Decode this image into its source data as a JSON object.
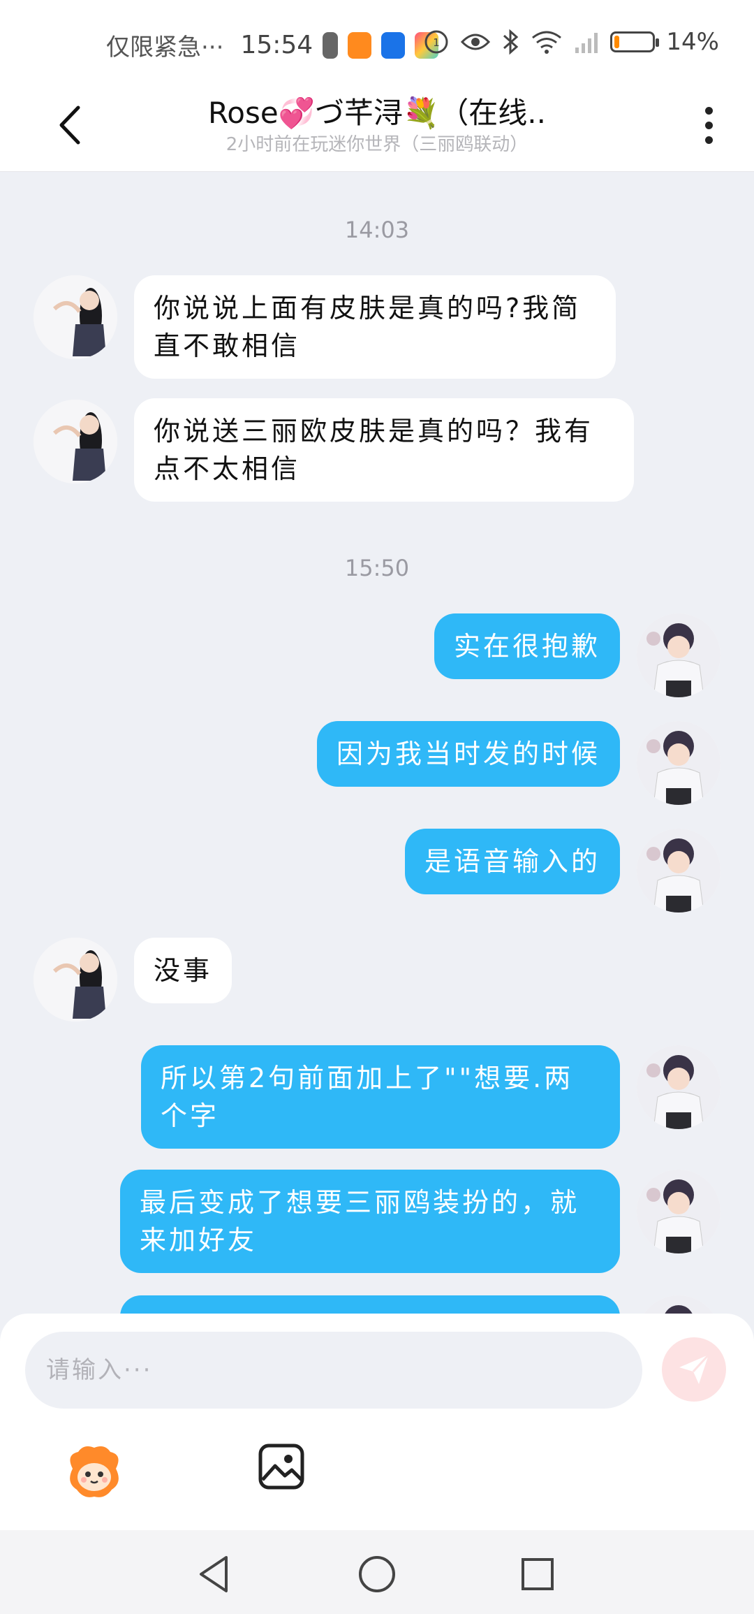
{
  "status_bar": {
    "notice": "仅限紧急···",
    "time": "15:54",
    "battery_text": "14%",
    "battery_level": 0.14,
    "app_icon_colors": [
      "#666666",
      "#ff8a1e",
      "#1a73e8",
      "#ff4f7b"
    ]
  },
  "header": {
    "title": "Rose💞づ芊浔💐（在线..",
    "subtitle": "2小时前在玩迷你世界（三丽鸥联动）"
  },
  "chat": {
    "timestamps": [
      "14:03",
      "15:50"
    ],
    "messages": [
      {
        "side": "in",
        "text": "你说说上面有皮肤是真的吗?我简直不敢相信"
      },
      {
        "side": "in",
        "text": "你说送三丽欧皮肤是真的吗？我有点不太相信"
      },
      {
        "side": "out",
        "text": "实在很抱歉"
      },
      {
        "side": "out",
        "text": "因为我当时发的时候"
      },
      {
        "side": "out",
        "text": "是语音输入的"
      },
      {
        "side": "in",
        "text": "没事"
      },
      {
        "side": "out",
        "text": "所以第2句前面加上了\"\"想要.两个字"
      },
      {
        "side": "out",
        "text": "最后变成了想要三丽鸥装扮的，就来加好友"
      }
    ]
  },
  "input": {
    "placeholder": "请输入···"
  },
  "colors": {
    "accent": "#2fb8f7",
    "background": "#eef0f5",
    "send_disabled": "#fde2e3"
  },
  "icons": {
    "back": "chevron-left-icon",
    "more": "more-vertical-icon",
    "send": "send-icon",
    "mascot": "mascot-sticker-icon",
    "image": "image-icon",
    "nav_back": "triangle-back-icon",
    "nav_home": "circle-home-icon",
    "nav_recent": "square-recent-icon"
  }
}
